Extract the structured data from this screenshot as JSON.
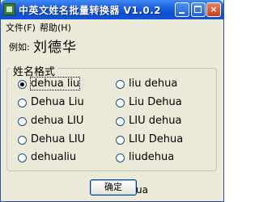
{
  "window": {
    "title": "中英文姓名批量转换器 V1.0.2"
  },
  "titlebar_buttons": {
    "minimize_icon": "minimize-icon",
    "maximize_icon": "maximize-icon",
    "close_glyph": "×"
  },
  "menu": {
    "file": "文件(F)",
    "help": "帮助(H)"
  },
  "example": {
    "label": "例如:",
    "value": "刘德华"
  },
  "group": {
    "title": "姓名格式"
  },
  "options": {
    "left": [
      {
        "label": "dehua liu",
        "checked": true
      },
      {
        "label": "Dehua Liu",
        "checked": false
      },
      {
        "label": "dehua LIU",
        "checked": false
      },
      {
        "label": "Dehua LIU",
        "checked": false
      },
      {
        "label": "dehualiu",
        "checked": false
      }
    ],
    "right": [
      {
        "label": "liu dehua",
        "checked": false
      },
      {
        "label": "Liu Dehua",
        "checked": false
      },
      {
        "label": "LIU dehua",
        "checked": false
      },
      {
        "label": "LIU Dehua",
        "checked": false
      },
      {
        "label": "liudehua",
        "checked": false
      }
    ]
  },
  "buttons": {
    "ok": "确定"
  },
  "stray": {
    "text": "ua"
  }
}
